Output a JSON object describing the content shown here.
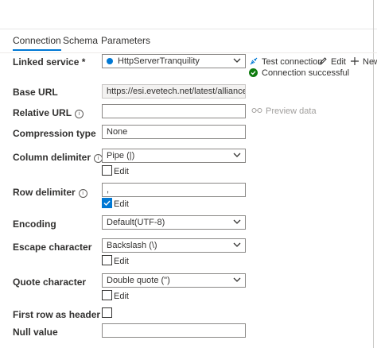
{
  "tabs": [
    {
      "label": "Connection",
      "active": true
    },
    {
      "label": "Schema",
      "active": false
    },
    {
      "label": "Parameters",
      "active": false
    }
  ],
  "linked_service": {
    "label": "Linked service *",
    "value": "HttpServerTranquility",
    "test_connection": "Test connection",
    "edit": "Edit",
    "new": "New",
    "status": "Connection successful"
  },
  "base_url": {
    "label": "Base URL",
    "value": "https://esi.evetech.net/latest/alliances/?dat"
  },
  "relative_url": {
    "label": "Relative URL",
    "value": "",
    "preview": "Preview data"
  },
  "compression": {
    "label": "Compression type",
    "value": "None"
  },
  "column_delimiter": {
    "label": "Column delimiter",
    "value": "Pipe (|)",
    "edit_label": "Edit",
    "edit_checked": false
  },
  "row_delimiter": {
    "label": "Row delimiter",
    "value": ",",
    "edit_label": "Edit",
    "edit_checked": true
  },
  "encoding": {
    "label": "Encoding",
    "value": "Default(UTF-8)"
  },
  "escape_character": {
    "label": "Escape character",
    "value": "Backslash (\\)",
    "edit_label": "Edit",
    "edit_checked": false
  },
  "quote_character": {
    "label": "Quote character",
    "value": "Double quote (\")",
    "edit_label": "Edit",
    "edit_checked": false
  },
  "first_row_header": {
    "label": "First row as header",
    "checked": false
  },
  "null_value": {
    "label": "Null value",
    "value": ""
  },
  "colors": {
    "accent": "#0078d4",
    "success": "#107c10"
  }
}
